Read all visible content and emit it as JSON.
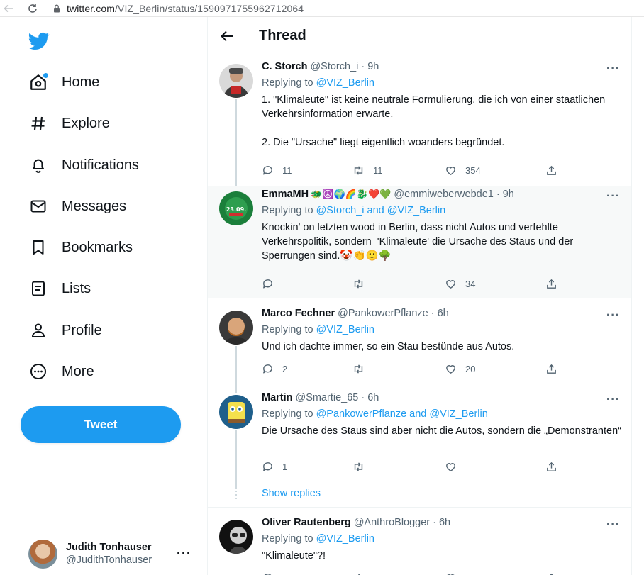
{
  "browser": {
    "url_host": "twitter.com",
    "url_path": "/VIZ_Berlin/status/1590971755962712064"
  },
  "sidebar": {
    "items": [
      {
        "label": "Home",
        "icon": "home-icon"
      },
      {
        "label": "Explore",
        "icon": "hashtag-icon"
      },
      {
        "label": "Notifications",
        "icon": "bell-icon"
      },
      {
        "label": "Messages",
        "icon": "envelope-icon"
      },
      {
        "label": "Bookmarks",
        "icon": "bookmark-icon"
      },
      {
        "label": "Lists",
        "icon": "list-icon"
      },
      {
        "label": "Profile",
        "icon": "person-icon"
      },
      {
        "label": "More",
        "icon": "more-circle-icon"
      }
    ],
    "tweet_button": "Tweet",
    "account": {
      "display_name": "Judith Tonhauser",
      "handle": "@JudithTonhauser",
      "more": "···"
    }
  },
  "header": {
    "title": "Thread"
  },
  "tweets": [
    {
      "display_name": "C. Storch",
      "handle": "@Storch_i",
      "time": "· 9h",
      "reply_prefix": "Replying to ",
      "reply_to": "@VIZ_Berlin",
      "text": "1. \"Klimaleute\" ist keine neutrale Formulierung, die ich von einer staatlichen Verkehrsinformation erwarte.\n\n2. Die \"Ursache\" liegt eigentlich woanders begründet.",
      "replies": "11",
      "retweets": "11",
      "likes": "354"
    },
    {
      "display_name": "EmmaMH",
      "emoji": "🐲☮️🌍🌈🐉❤️💚",
      "handle": "@emmiweberwebde1",
      "time": "· 9h",
      "reply_prefix": "Replying to ",
      "reply_to": "@Storch_i and @VIZ_Berlin",
      "text": "Knockin' on letzten wood in Berlin, dass nicht Autos und verfehlte Verkehrspolitik, sondern  'Klimaleute' die Ursache des Staus und der Sperrungen sind.🤡👏🙂🌳",
      "replies": "",
      "retweets": "",
      "likes": "34"
    },
    {
      "display_name": "Marco Fechner",
      "handle": "@PankowerPflanze",
      "time": "· 6h",
      "reply_prefix": "Replying to ",
      "reply_to": "@VIZ_Berlin",
      "text": "Und ich dachte immer, so ein Stau bestünde aus Autos.",
      "replies": "2",
      "retweets": "",
      "likes": "20"
    },
    {
      "display_name": "Martin",
      "handle": "@Smartie_65",
      "time": "· 6h",
      "reply_prefix": "Replying to ",
      "reply_to": "@PankowerPflanze and @VIZ_Berlin",
      "text": "Die Ursache des Staus sind aber nicht die Autos, sondern die „Demonstranten“",
      "replies": "1",
      "retweets": "",
      "likes": ""
    },
    {
      "display_name": "Oliver Rautenberg",
      "handle": "@AnthroBlogger",
      "time": "· 6h",
      "reply_prefix": "Replying to ",
      "reply_to": "@VIZ_Berlin",
      "text": "\"Klimaleute\"?!",
      "replies": "",
      "retweets": "",
      "likes": ""
    }
  ],
  "show_replies": "Show replies",
  "more_label": "···",
  "colors": {
    "accent": "#1d9bf0",
    "text": "#0f1419",
    "secondary": "#536471",
    "highlight_bg": "#f7f9f9"
  }
}
